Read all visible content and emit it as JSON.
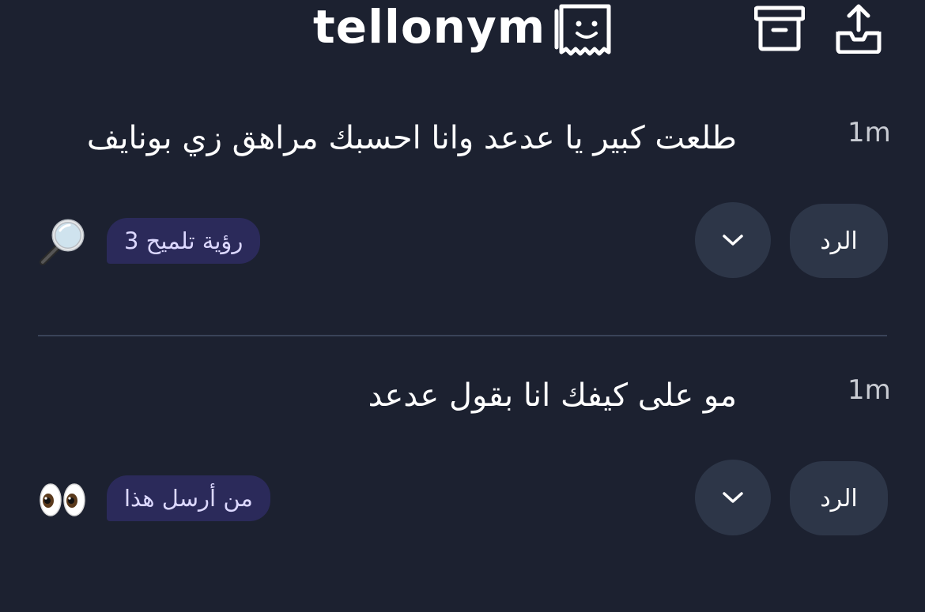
{
  "header": {
    "brand": "tellonym",
    "brand_icon": "tellonym-logo-icon",
    "archive_icon": "archive-box-icon",
    "share_icon": "share-tray-icon"
  },
  "cards": [
    {
      "question": "طلعت كبير يا عدعد وانا احسبك مراهق زي بونايف",
      "time": "1m",
      "reply_label": "الرد",
      "more_icon": "chevron-down-icon",
      "hint_label": "رؤية تلميح 3",
      "emoji": "magnifying-glass-emoji"
    },
    {
      "question": "مو على كيفك انا بقول عدعد",
      "time": "1m",
      "reply_label": "الرد",
      "more_icon": "chevron-down-icon",
      "hint_label": "من أرسل هذا",
      "emoji": "eyes-emoji"
    }
  ],
  "colors": {
    "background": "#1c2130",
    "button_bg": "#2d3648",
    "pill_bg": "#2b2a5a",
    "pill_text": "#dcd8ff",
    "divider": "#3a4358"
  }
}
